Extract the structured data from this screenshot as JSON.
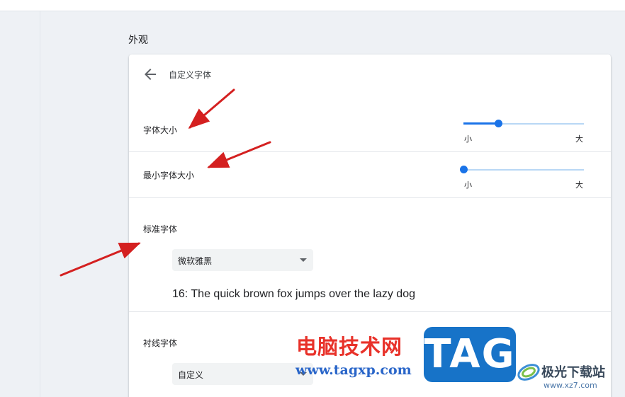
{
  "section": {
    "title": "外观"
  },
  "card": {
    "title": "自定义字体",
    "back_icon": "arrow-left-icon"
  },
  "rows": {
    "font_size": {
      "label": "字体大小",
      "slider": {
        "min_label": "小",
        "max_label": "大",
        "value": 0.29
      }
    },
    "min_font_size": {
      "label": "最小字体大小",
      "slider": {
        "min_label": "小",
        "max_label": "大",
        "value": 0.0
      }
    },
    "standard_font": {
      "label": "标准字体",
      "select_value": "微软雅黑",
      "sample": "16: The quick brown fox jumps over the lazy dog"
    },
    "serif_font": {
      "label": "衬线字体",
      "select_value": "自定义"
    }
  },
  "watermark": {
    "text": "电脑技术网",
    "url": "www.tagxp.com",
    "tag": "TAG",
    "site": "极光下载站",
    "site_url": "www.xz7.com"
  },
  "colors": {
    "accent": "#1a73e8",
    "annotation_arrow": "#d42020",
    "watermark_red": "#e8322a",
    "watermark_blue": "#1773c8"
  }
}
